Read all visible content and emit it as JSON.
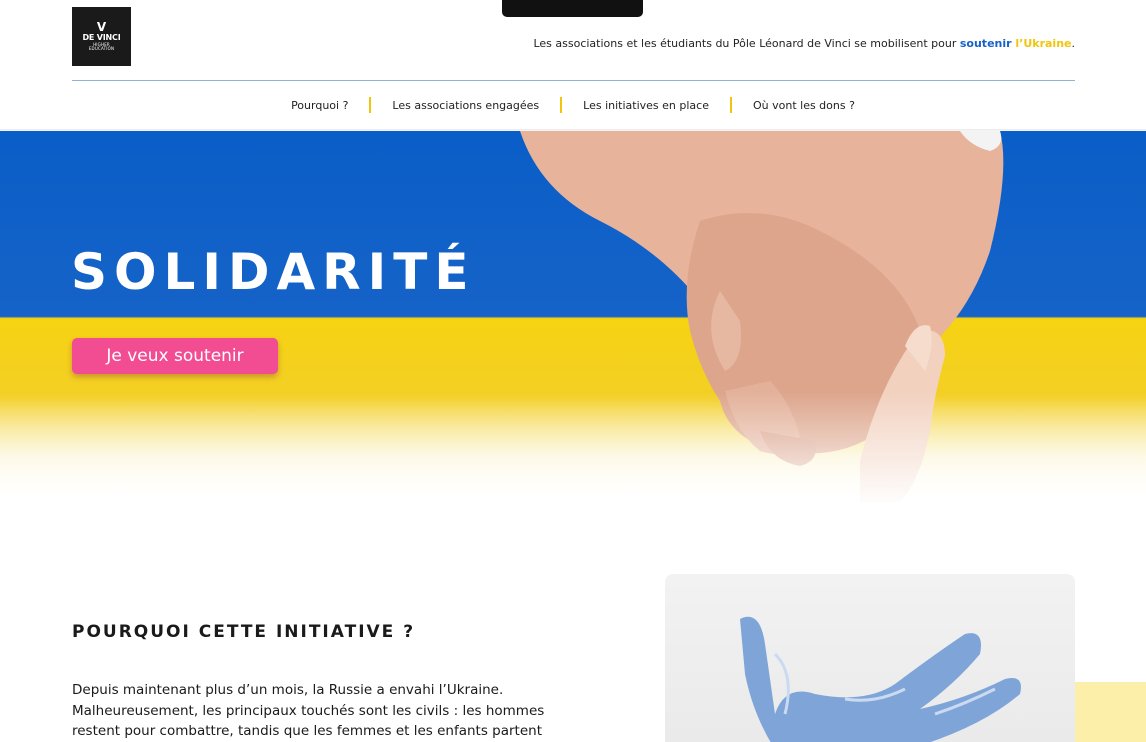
{
  "header": {
    "logo": {
      "mark": "V",
      "name": "DE VINCI",
      "sub1": "HIGHER",
      "sub2": "EDUCATION"
    },
    "tagline": {
      "text": "Les associations et les étudiants du Pôle Léonard de Vinci se mobilisent pour ",
      "highlight_blue": "soutenir",
      "highlight_yellow": " l’Ukraine",
      "end": "."
    }
  },
  "nav": {
    "items": [
      {
        "label": "Pourquoi ?"
      },
      {
        "label": "Les associations engagées"
      },
      {
        "label": "Les initiatives en place"
      },
      {
        "label": "Où vont les dons ?"
      }
    ],
    "separator_color": "#f2c40a"
  },
  "hero": {
    "title": "SOLIDARITÉ",
    "button_label": "Je veux soutenir",
    "colors": {
      "blue": "#0a5ec7",
      "yellow": "#f6d312",
      "button": "#f24c93"
    }
  },
  "section": {
    "title": "POURQUOI CETTE INITIATIVE ?",
    "body_line1": "Depuis maintenant plus d’un mois, la Russie a envahi l’Ukraine.",
    "body_line2": "Malheureusement, les principaux touchés sont les civils : les hommes",
    "body_line3": "restent pour combattre, tandis que les femmes et les enfants partent"
  }
}
